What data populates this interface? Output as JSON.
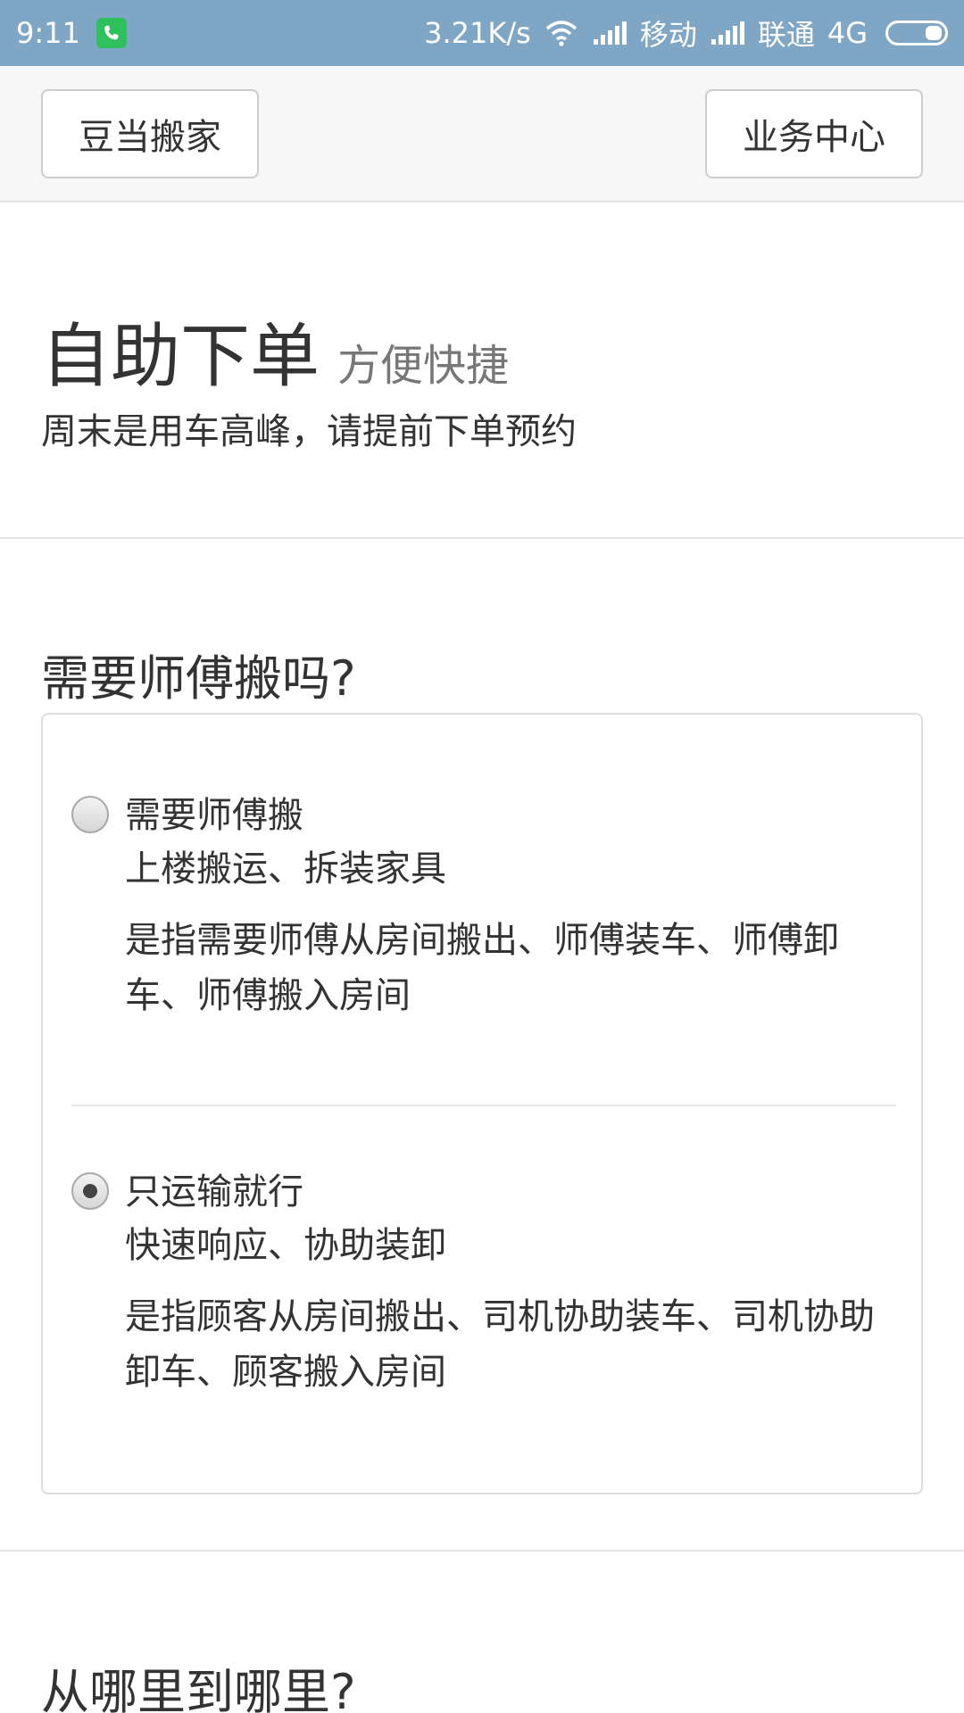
{
  "status_bar": {
    "time": "9:11",
    "net_speed": "3.21K/s",
    "carrier1": "移动",
    "carrier2": "联通",
    "network": "4G",
    "icons": [
      "phone-icon",
      "wifi-icon",
      "signal-icon",
      "signal-icon",
      "battery-icon"
    ]
  },
  "nav": {
    "left_label": "豆当搬家",
    "right_label": "业务中心"
  },
  "hero": {
    "title": "自助下单",
    "subtitle": "方便快捷",
    "note": "周末是用车高峰，请提前下单预约"
  },
  "section1": {
    "heading": "需要师傅搬吗?",
    "options": [
      {
        "title": "需要师傅搬",
        "subtitle": "上楼搬运、拆装家具",
        "description": "是指需要师傅从房间搬出、师傅装车、师傅卸车、师傅搬入房间",
        "selected": false
      },
      {
        "title": "只运输就行",
        "subtitle": "快速响应、协助装卸",
        "description": "是指顾客从房间搬出、司机协助装车、司机协助卸车、顾客搬入房间",
        "selected": true
      }
    ]
  },
  "section2": {
    "heading": "从哪里到哪里?"
  }
}
